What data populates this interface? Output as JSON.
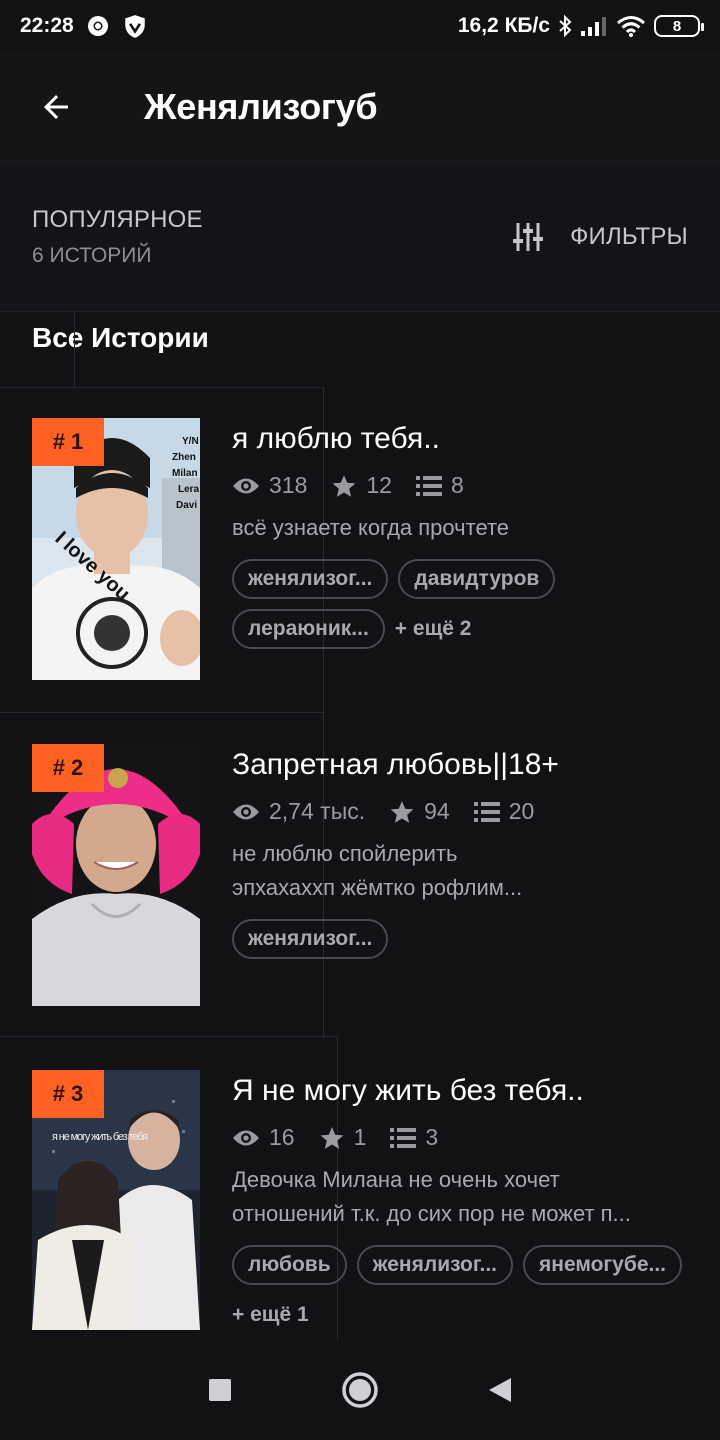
{
  "status": {
    "time": "22:28",
    "speed": "16,2 КБ/с",
    "battery": "8"
  },
  "header": {
    "title": "Женялизогуб"
  },
  "section": {
    "sort_title": "ПОПУЛЯРНОЕ",
    "count": "6 ИСТОРИЙ",
    "filters_label": "ФИЛЬТРЫ",
    "all_stories": "Все Истории"
  },
  "stories": [
    {
      "rank": "# 1",
      "title": "я люблю тебя..",
      "views": "318",
      "votes": "12",
      "parts": "8",
      "description": "всё узнаете когда прочтете",
      "tags": [
        "женялизог...",
        "давидтуров",
        "лераюник..."
      ],
      "more_tags": "+ ещё 2",
      "cover_text": [
        "Y/N",
        "Zhen",
        "Milan",
        "Lera",
        "Davi"
      ],
      "cover_caption": "I love you"
    },
    {
      "rank": "# 2",
      "title": "Запретная любовь||18+",
      "views": "2,74 тыс.",
      "votes": "94",
      "parts": "20",
      "description": "не люблю спойлерить\nэпхахаххп жёмтко рофлим...",
      "tags": [
        "женялизог..."
      ],
      "more_tags": ""
    },
    {
      "rank": "# 3",
      "title": "Я не могу жить без тебя..",
      "views": "16",
      "votes": "1",
      "parts": "3",
      "description": "Девочка Милана не очень хочет\nотношений т.к. до сих пор не может п...",
      "tags": [
        "любовь",
        "женялизог...",
        "янемогубе..."
      ],
      "more_tags": "+ ещё 1",
      "cover_caption": "я не могу жить без тебя"
    }
  ],
  "colors": {
    "accent": "#ff6122",
    "background": "#121114"
  }
}
